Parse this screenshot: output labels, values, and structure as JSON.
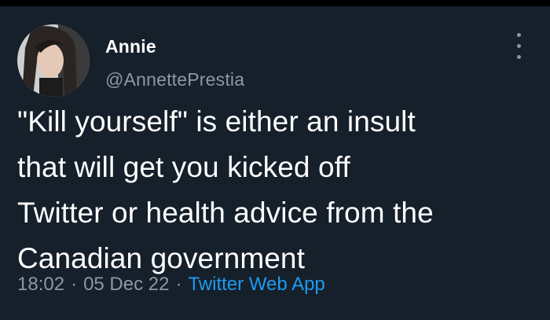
{
  "tweet": {
    "author": {
      "display_name": "Annie",
      "handle": "@AnnettePrestia",
      "avatar_icon": "profile-photo"
    },
    "text_lines": [
      "\"Kill yourself\" is either an insult",
      "that will get you kicked off",
      "Twitter or health advice from the",
      "Canadian government"
    ],
    "time": "18:02",
    "separator": "·",
    "date": "05 Dec 22",
    "source": "Twitter Web App",
    "more_icon": "more-vertical-icon"
  },
  "colors": {
    "background": "#15202b",
    "text_primary": "#ffffff",
    "text_secondary": "#8b98a5",
    "link": "#1d9bf0"
  }
}
